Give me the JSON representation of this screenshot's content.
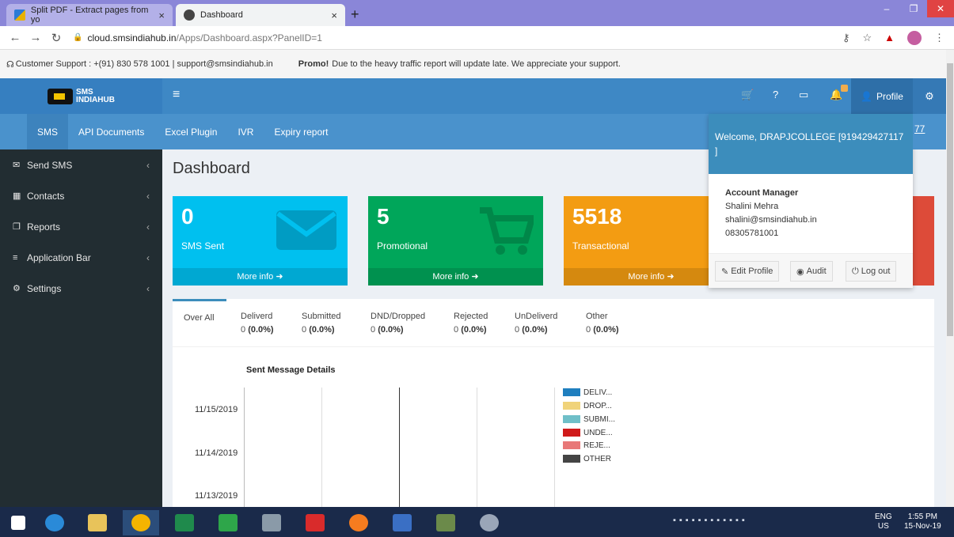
{
  "browser": {
    "tabs": [
      {
        "title": "Split PDF - Extract pages from yo",
        "close": "×"
      },
      {
        "title": "Dashboard",
        "close": "×"
      }
    ],
    "new_tab": "+",
    "url_host": "cloud.smsindiahub.in",
    "url_path": "/Apps/Dashboard.aspx?PanelID=1"
  },
  "support": {
    "text": "Customer Support : +(91) 830 578 1001 | support@smsindiahub.in",
    "promo_label": "Promo!",
    "promo_text": "Due to the heavy traffic report will update late. We appreciate your support."
  },
  "header": {
    "logo_line1": "SMS",
    "logo_line2": "INDIAHUB",
    "profile_label": "Profile"
  },
  "subnav": [
    "SMS",
    "API Documents",
    "Excel Plugin",
    "IVR",
    "Expiry report"
  ],
  "sidebar": [
    {
      "icon": "send-icon",
      "label": "Send SMS"
    },
    {
      "icon": "contacts-icon",
      "label": "Contacts"
    },
    {
      "icon": "reports-icon",
      "label": "Reports"
    },
    {
      "icon": "menu-icon",
      "label": "Application Bar"
    },
    {
      "icon": "settings-icon",
      "label": "Settings"
    }
  ],
  "dashboard": {
    "title": "Dashboard",
    "cards": [
      {
        "value": "0",
        "label": "SMS Sent",
        "more": "More info",
        "color": "#00c0ef"
      },
      {
        "value": "5",
        "label": "Promotional",
        "more": "More info",
        "color": "#00a65a"
      },
      {
        "value": "5518",
        "label": "Transactional",
        "more": "More info",
        "color": "#f39c12"
      }
    ]
  },
  "stats": {
    "overall": "Over All",
    "tabs": [
      {
        "label": "Deliverd",
        "count": "0",
        "pct": "(0.0%)"
      },
      {
        "label": "Submitted",
        "count": "0",
        "pct": "(0.0%)"
      },
      {
        "label": "DND/Dropped",
        "count": "0",
        "pct": "(0.0%)"
      },
      {
        "label": "Rejected",
        "count": "0",
        "pct": "(0.0%)"
      },
      {
        "label": "UnDeliverd",
        "count": "0",
        "pct": "(0.0%)"
      },
      {
        "label": "Other",
        "count": "0",
        "pct": "(0.0%)"
      }
    ]
  },
  "chart_data": {
    "type": "bar",
    "title": "Sent Message Details",
    "categories": [
      "11/15/2019",
      "11/14/2019",
      "11/13/2019"
    ],
    "series": [
      {
        "name": "DELIV...",
        "color": "#1f7fbf",
        "values": [
          0,
          0,
          0
        ]
      },
      {
        "name": "DROP...",
        "color": "#f0d37a",
        "values": [
          0,
          0,
          0
        ]
      },
      {
        "name": "SUBMI...",
        "color": "#6fbfc8",
        "values": [
          0,
          0,
          0
        ]
      },
      {
        "name": "UNDE...",
        "color": "#d01a1a",
        "values": [
          0,
          0,
          0
        ]
      },
      {
        "name": "REJE...",
        "color": "#e87878",
        "values": [
          0,
          0,
          0
        ]
      },
      {
        "name": "OTHER",
        "color": "#444444",
        "values": [
          0,
          0,
          0
        ]
      }
    ]
  },
  "profile_dropdown": {
    "welcome": "Welcome, DRAPJCOLLEGE [919429427117 ]",
    "edge_text": "77",
    "manager_title": "Account Manager",
    "manager_name": "Shalini Mehra",
    "manager_email": "shalini@smsindiahub.in",
    "manager_phone": "08305781001",
    "buttons": [
      "Edit Profile",
      "Audit",
      "Log out"
    ]
  },
  "taskbar": {
    "lang1": "ENG",
    "lang2": "US",
    "time": "1:55 PM",
    "date": "15-Nov-19"
  }
}
